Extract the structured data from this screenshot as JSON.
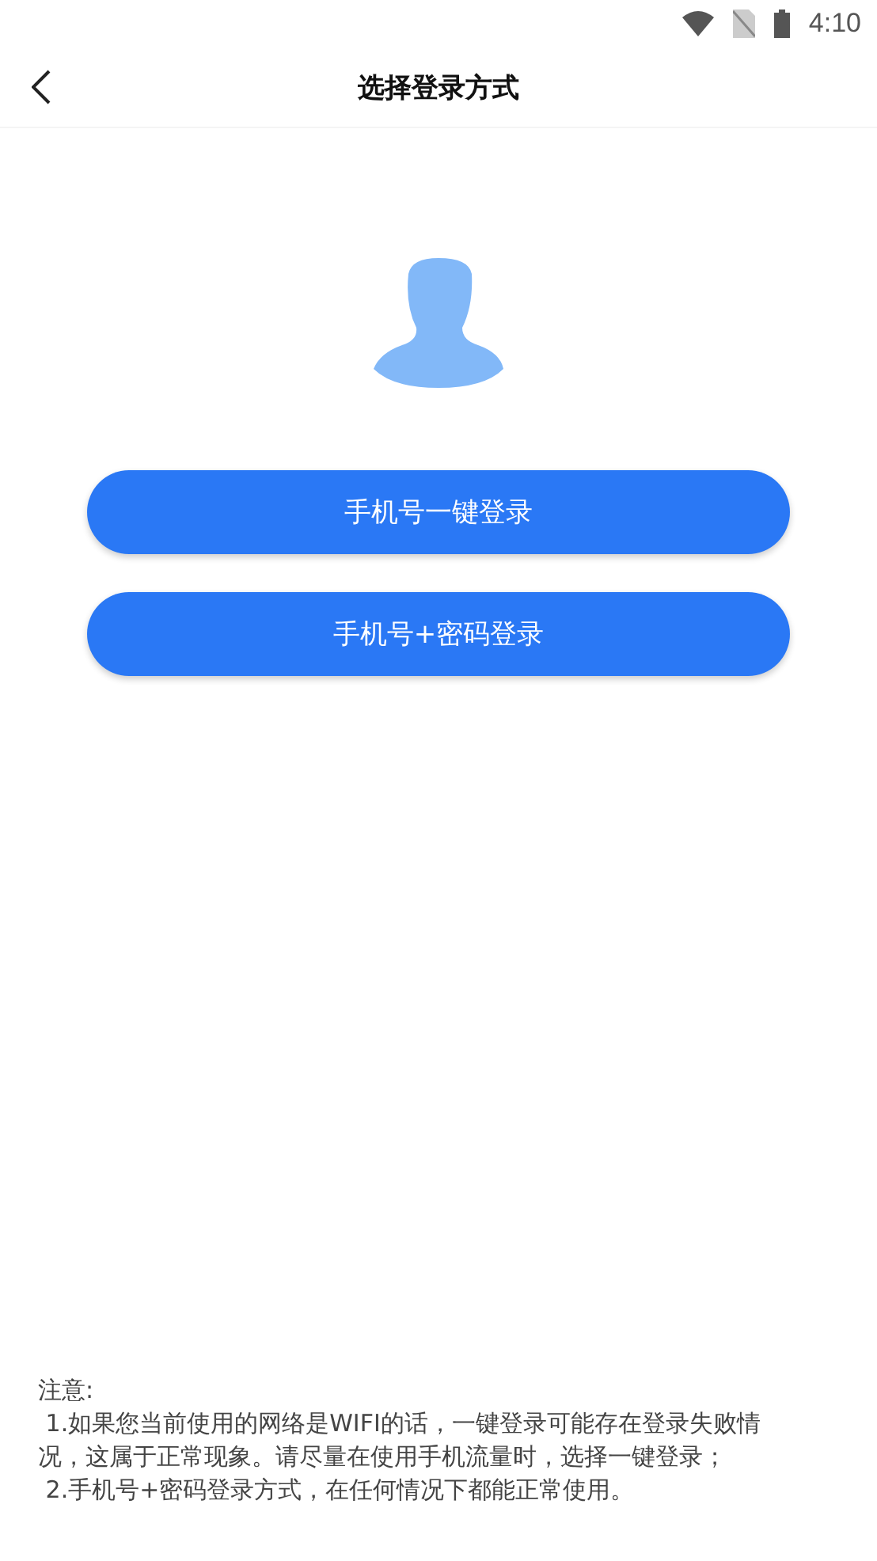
{
  "status_bar": {
    "time": "4:10"
  },
  "header": {
    "title": "选择登录方式"
  },
  "buttons": [
    {
      "label": "手机号一键登录"
    },
    {
      "label": "手机号+密码登录"
    }
  ],
  "notes": {
    "heading": "注意:",
    "items": [
      " 1.如果您当前使用的网络是WIFI的话，一键登录可能存在登录失败情况，这属于正常现象。请尽量在使用手机流量时，选择一键登录；",
      " 2.手机号+密码登录方式，在任何情况下都能正常使用。"
    ]
  }
}
